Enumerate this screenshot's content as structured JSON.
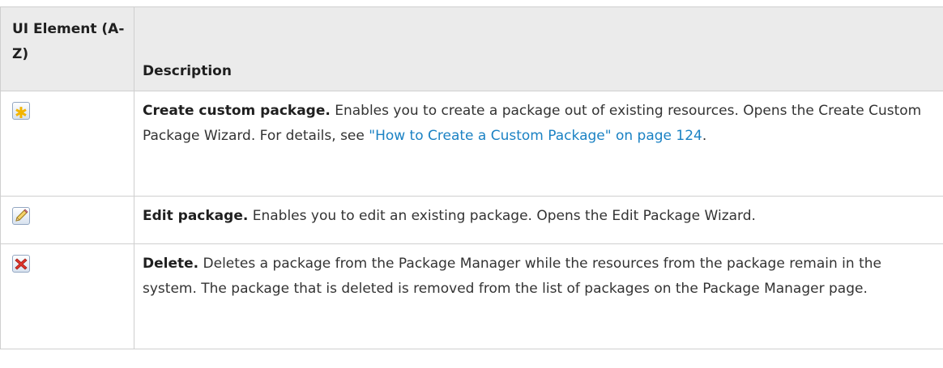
{
  "table": {
    "headers": {
      "element": "UI Element (A-Z)",
      "description": "Description"
    },
    "rows": [
      {
        "icon": "create-custom-package-icon",
        "term": "Create custom package.",
        "text_before": " Enables you to create a package out of existing resources. Opens the Create Custom Package Wizard. For details, see ",
        "link": "\"How to Create a Custom Package\" on page 124",
        "text_after": "."
      },
      {
        "icon": "edit-package-icon",
        "term": "Edit package.",
        "text_before": " Enables you to edit an existing package. Opens the Edit Package Wizard."
      },
      {
        "icon": "delete-icon",
        "term": "Delete.",
        "text_before": " Deletes a package from the Package Manager while the resources from the package remain in the system. The package that is deleted is removed from the list of packages on the Package Manager page."
      }
    ]
  },
  "colors": {
    "link": "#1b82c4",
    "header_bg": "#ebebeb",
    "border": "#cfcfcf"
  }
}
